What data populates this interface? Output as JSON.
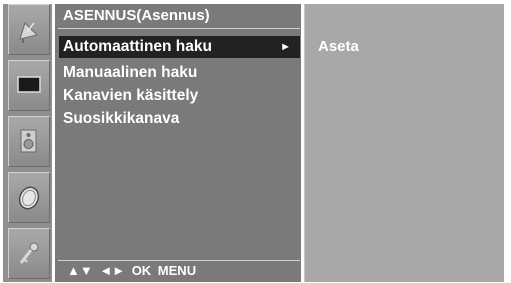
{
  "menu": {
    "title": "ASENNUS(Asennus)",
    "items": [
      {
        "label": "Automaattinen haku",
        "arrow": "►",
        "selected": true
      },
      {
        "label": "Manuaalinen haku"
      },
      {
        "label": "Kanavien käsittely"
      },
      {
        "label": "Suosikkikanava"
      }
    ],
    "hints": "▲▼ ◄► OK MENU"
  },
  "submenu": {
    "items": [
      {
        "label": "Aseta"
      }
    ]
  },
  "icons": [
    "satellite-dish-icon",
    "screen-icon",
    "speaker-icon",
    "clock-icon",
    "key-icon"
  ],
  "colors": {
    "menu_panel": "#7a7a7a",
    "submenu_panel": "#a8a8a8",
    "icon_column": "#8f8f8f",
    "selected_item": "#222222",
    "text": "#ffffff"
  }
}
